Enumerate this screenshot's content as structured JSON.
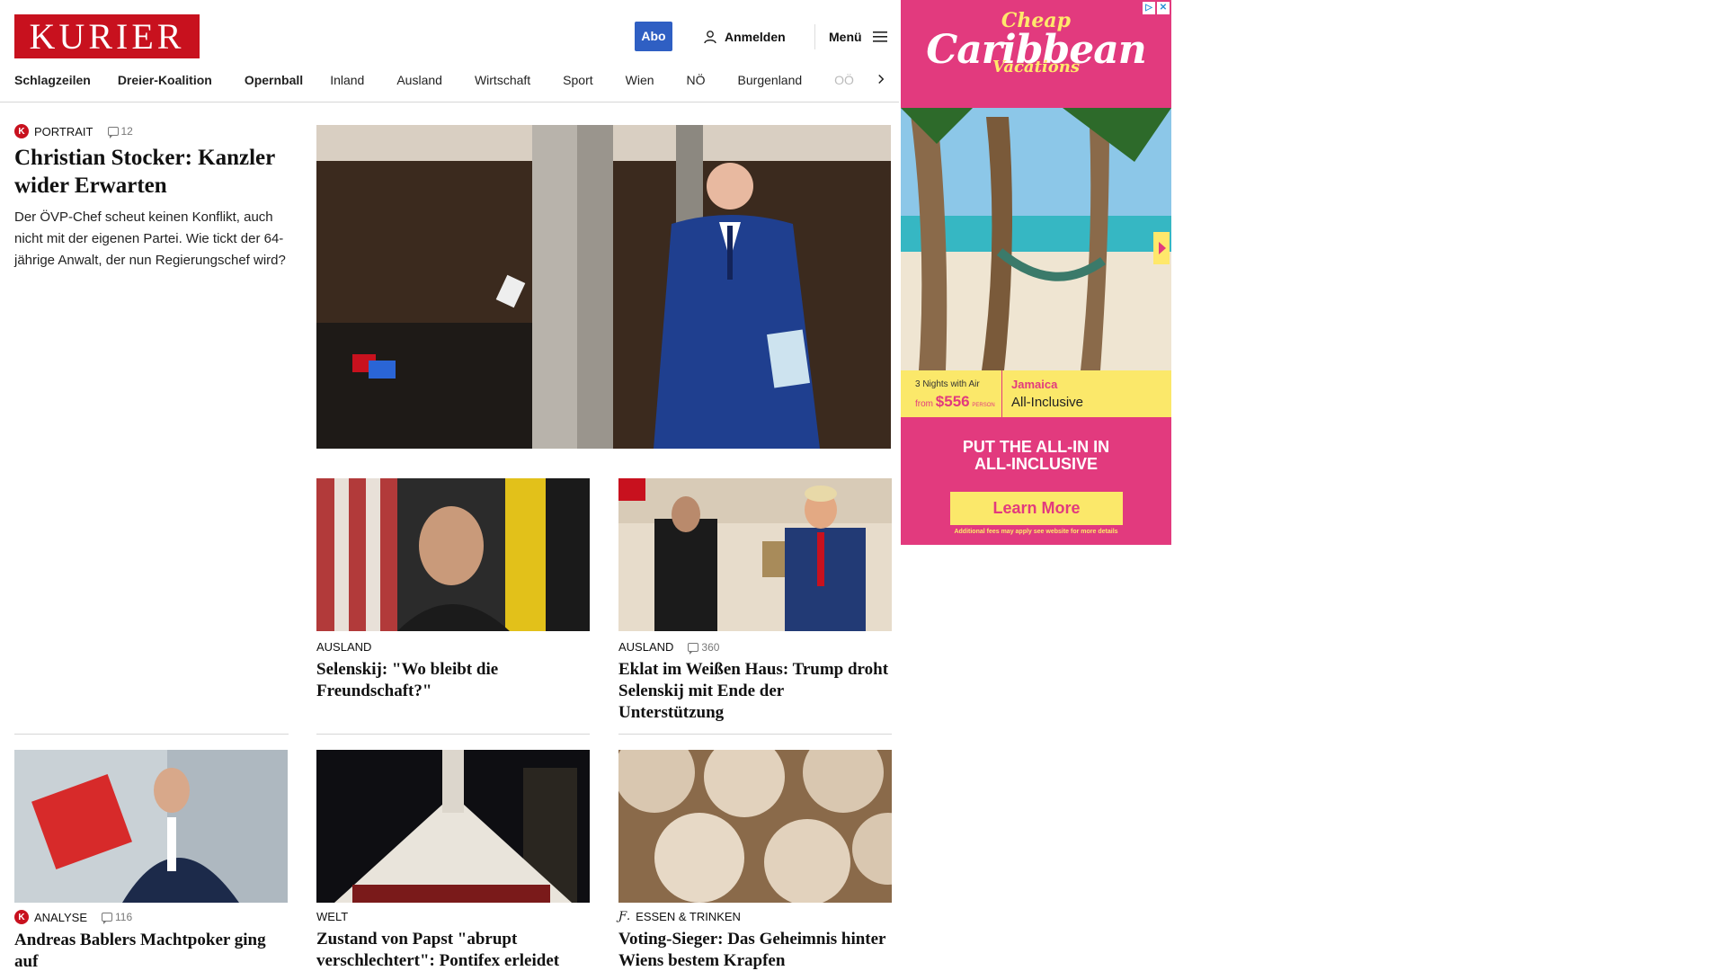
{
  "header": {
    "logo_text": "KURIER",
    "abo_label": "Abo",
    "login_label": "Anmelden",
    "menu_label": "Menü"
  },
  "nav": {
    "items": [
      "Schlagzeilen",
      "Dreier-Koalition",
      "Opernball",
      "Inland",
      "Ausland",
      "Wirtschaft",
      "Sport",
      "Wien",
      "NÖ",
      "Burgenland",
      "OÖ"
    ]
  },
  "lead": {
    "category": "PORTRAIT",
    "comments": "12",
    "title": "Christian Stocker: Kanzler wider Erwarten",
    "teaser": "Der ÖVP-Chef scheut keinen Konflikt, auch nicht mit der eigenen Partei. Wie tickt der 64-jährige Anwalt, der nun Regierungschef wird?",
    "image_alt": "Christian Stocker im blauen Anzug, Mikrofone im Vordergrund"
  },
  "cards": [
    {
      "category": "AUSLAND",
      "comments": "",
      "title": "Selenskij: \"Wo bleibt die Freundschaft?\""
    },
    {
      "category": "AUSLAND",
      "comments": "360",
      "title": "Eklat im Weißen Haus: Trump droht Selenskij mit Ende der Unterstützung"
    },
    {
      "category": "ANALYSE",
      "comments": "116",
      "title": "Andreas Bablers Machtpoker ging auf"
    },
    {
      "category": "WELT",
      "comments": "",
      "title": "Zustand von Papst \"abrupt verschlechtert\": Pontifex erleidet erneute \"Atemkrise\""
    },
    {
      "category": "ESSEN & TRINKEN",
      "comments": "",
      "title": "Voting-Sieger: Das Geheimnis hinter Wiens bestem Krapfen"
    }
  ],
  "ad": {
    "headline_top": "Cheap",
    "headline_main": "Caribbean",
    "headline_sub": "Vacations",
    "nights": "3 Nights with Air",
    "from_label": "from",
    "price": "$556",
    "price_suffix": "PERSON",
    "destination": "Jamaica",
    "package": "All-Inclusive",
    "cta_line1": "PUT THE ALL-IN IN",
    "cta_line2": "ALL-INCLUSIVE",
    "button": "Learn More",
    "fine_print": "Additional fees may apply see website for more details"
  },
  "colors": {
    "brand_red": "#c8111e",
    "abo_blue": "#2f5fc3",
    "ad_pink": "#e23a7e",
    "ad_yellow": "#fbe86a"
  }
}
